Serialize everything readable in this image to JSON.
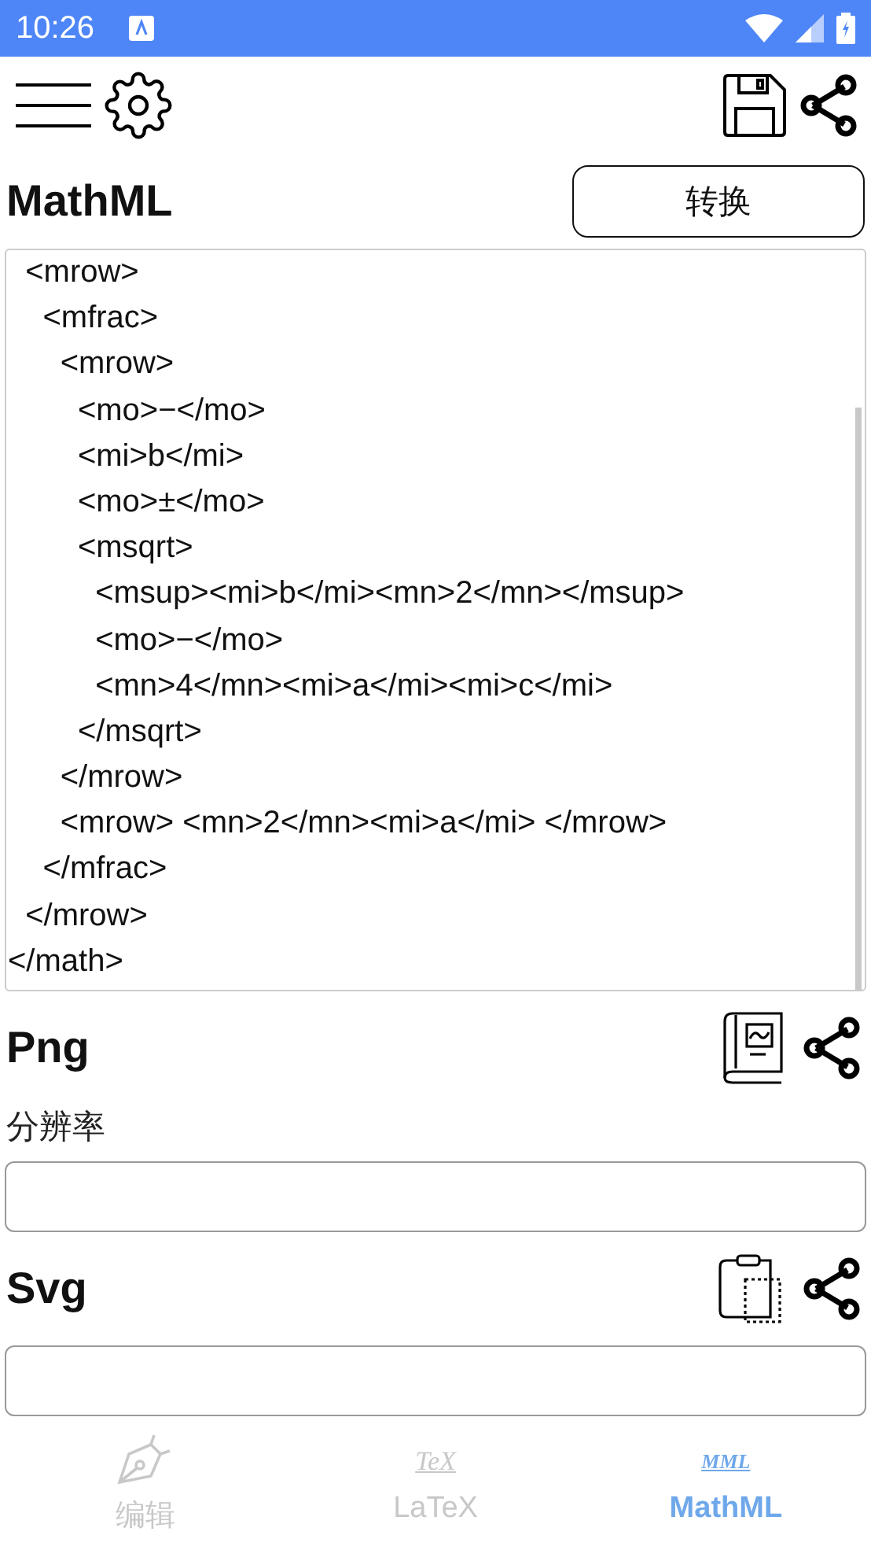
{
  "status_bar": {
    "time": "10:26"
  },
  "editor": {
    "title": "MathML",
    "convert_button": "转换",
    "code_lines": [
      "  <mrow>",
      "    <mfrac>",
      "      <mrow>",
      "        <mo>−</mo>",
      "        <mi>b</mi>",
      "        <mo>±</mo>",
      "        <msqrt>",
      "          <msup><mi>b</mi><mn>2</mn></msup>",
      "          <mo>−</mo>",
      "          <mn>4</mn><mi>a</mi><mi>c</mi>",
      "        </msqrt>",
      "      </mrow>",
      "      <mrow> <mn>2</mn><mi>a</mi> </mrow>",
      "    </mfrac>",
      "  </mrow>",
      "</math>"
    ]
  },
  "png": {
    "title": "Png",
    "resolution_label": "分辨率"
  },
  "svg": {
    "title": "Svg"
  },
  "tabs": [
    {
      "kind": "pen",
      "label": "编辑",
      "selected": false
    },
    {
      "kind": "tex",
      "icon_text": "TeX",
      "label": "LaTeX",
      "selected": false
    },
    {
      "kind": "mml",
      "icon_text": "MML",
      "label": "MathML",
      "selected": true
    }
  ]
}
